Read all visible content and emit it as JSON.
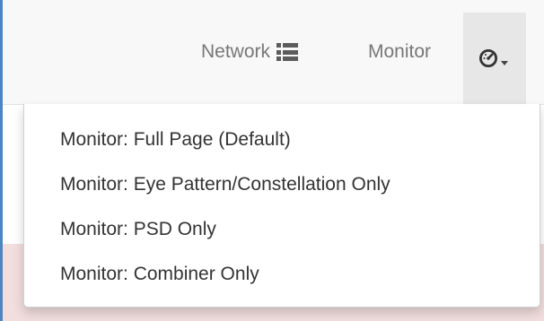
{
  "navbar": {
    "items": [
      {
        "label": "Network",
        "icon": "list-icon"
      },
      {
        "label": "Monitor",
        "icon": "dashboard-gauge-icon"
      }
    ]
  },
  "monitor_menu": {
    "items": [
      {
        "label": "Monitor: Full Page (Default)"
      },
      {
        "label": "Monitor: Eye Pattern/Constellation Only"
      },
      {
        "label": "Monitor: PSD Only"
      },
      {
        "label": "Monitor: Combiner Only"
      }
    ]
  },
  "colors": {
    "navbar_bg": "#f8f8f8",
    "active_toggle_bg": "#e7e7e7",
    "nav_text": "#777777",
    "menu_text": "#333333",
    "alert_bg": "#f2dede"
  }
}
